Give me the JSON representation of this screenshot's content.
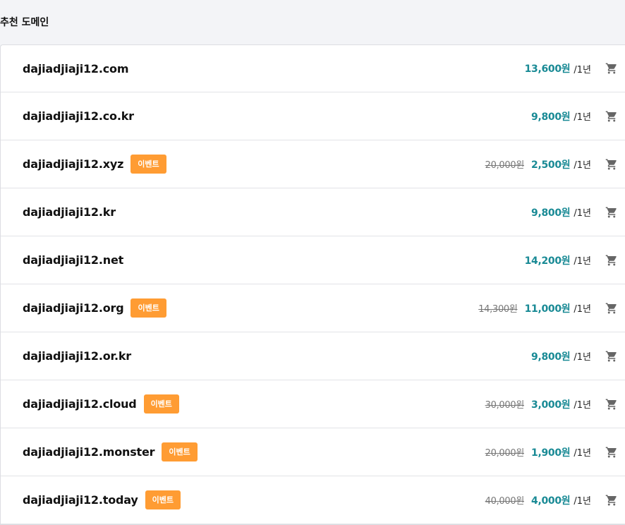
{
  "section": {
    "title": "추천 도메인"
  },
  "colors": {
    "accent": "#198a95",
    "badge": "#ff9c33",
    "cart_icon": "#666666"
  },
  "domains": [
    {
      "name": "dajiadjiaji12.com",
      "badge": "",
      "old_price": "",
      "price": "13,600원",
      "period": "/1년",
      "icon": "cart-icon"
    },
    {
      "name": "dajiadjiaji12.co.kr",
      "badge": "",
      "old_price": "",
      "price": "9,800원",
      "period": "/1년",
      "icon": "cart-icon"
    },
    {
      "name": "dajiadjiaji12.xyz",
      "badge": "이벤트",
      "old_price": "20,000원",
      "price": "2,500원",
      "period": "/1년",
      "icon": "cart-icon"
    },
    {
      "name": "dajiadjiaji12.kr",
      "badge": "",
      "old_price": "",
      "price": "9,800원",
      "period": "/1년",
      "icon": "cart-icon"
    },
    {
      "name": "dajiadjiaji12.net",
      "badge": "",
      "old_price": "",
      "price": "14,200원",
      "period": "/1년",
      "icon": "cart-icon"
    },
    {
      "name": "dajiadjiaji12.org",
      "badge": "이벤트",
      "old_price": "14,300원",
      "price": "11,000원",
      "period": "/1년",
      "icon": "cart-icon"
    },
    {
      "name": "dajiadjiaji12.or.kr",
      "badge": "",
      "old_price": "",
      "price": "9,800원",
      "period": "/1년",
      "icon": "cart-icon"
    },
    {
      "name": "dajiadjiaji12.cloud",
      "badge": "이벤트",
      "old_price": "30,000원",
      "price": "3,000원",
      "period": "/1년",
      "icon": "cart-icon"
    },
    {
      "name": "dajiadjiaji12.monster",
      "badge": "이벤트",
      "old_price": "20,000원",
      "price": "1,900원",
      "period": "/1년",
      "icon": "cart-icon"
    },
    {
      "name": "dajiadjiaji12.today",
      "badge": "이벤트",
      "old_price": "40,000원",
      "price": "4,000원",
      "period": "/1년",
      "icon": "cart-icon"
    }
  ]
}
